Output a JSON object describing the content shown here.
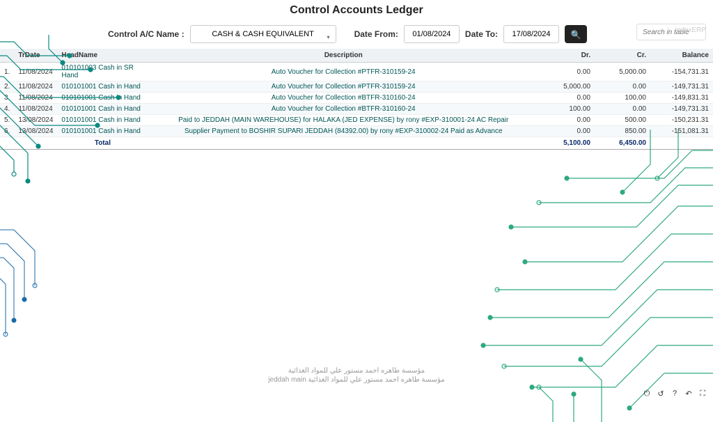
{
  "title": "Control Accounts Ledger",
  "filters": {
    "control_ac_label": "Control A/C Name :",
    "control_ac_value": "CASH & CASH EQUIVALENT",
    "date_from_label": "Date From:",
    "date_from": "01/08/2024",
    "date_to_label": "Date To:",
    "date_to": "17/08/2024",
    "search_placeholder": "Search in table"
  },
  "watermark": "indexERP",
  "columns": {
    "trdate": "TrDate",
    "headname": "HeadName",
    "description": "Description",
    "dr": "Dr.",
    "cr": "Cr.",
    "balance": "Balance"
  },
  "rows": [
    {
      "idx": "1.",
      "date": "11/08/2024",
      "head": "010101003 Cash in SR Hand",
      "desc": "Auto Voucher for Collection #PTFR-310159-24",
      "dr": "0.00",
      "cr": "5,000.00",
      "bal": "-154,731.31"
    },
    {
      "idx": "2.",
      "date": "11/08/2024",
      "head": "010101001 Cash in Hand",
      "desc": "Auto Voucher for Collection #PTFR-310159-24",
      "dr": "5,000.00",
      "cr": "0.00",
      "bal": "-149,731.31"
    },
    {
      "idx": "3.",
      "date": "11/08/2024",
      "head": "010101001 Cash in Hand",
      "desc": "Auto Voucher for Collection #BTFR-310160-24",
      "dr": "0.00",
      "cr": "100.00",
      "bal": "-149,831.31"
    },
    {
      "idx": "4.",
      "date": "11/08/2024",
      "head": "010101001 Cash in Hand",
      "desc": "Auto Voucher for Collection #BTFR-310160-24",
      "dr": "100.00",
      "cr": "0.00",
      "bal": "-149,731.31"
    },
    {
      "idx": "5.",
      "date": "13/08/2024",
      "head": "010101001 Cash in Hand",
      "desc": "Paid to JEDDAH (MAIN WAREHOUSE) for HALAKA (JED EXPENSE) by rony #EXP-310001-24 AC Repair",
      "dr": "0.00",
      "cr": "500.00",
      "bal": "-150,231.31"
    },
    {
      "idx": "6.",
      "date": "13/08/2024",
      "head": "010101001 Cash in Hand",
      "desc": "Supplier Payment to BOSHIR SUPARI JEDDAH (84392.00) by rony #EXP-310002-24 Paid as Advance",
      "dr": "0.00",
      "cr": "850.00",
      "bal": "-151,081.31"
    }
  ],
  "totals": {
    "label": "Total",
    "dr": "5,100.00",
    "cr": "6,450.00"
  },
  "footer": {
    "line1": "مؤسسة طاهره احمد مستور علي للمواد الغذائية",
    "line2": "jeddah main مؤسسة طاهره احمد مستور علي للمواد الغذائية"
  }
}
